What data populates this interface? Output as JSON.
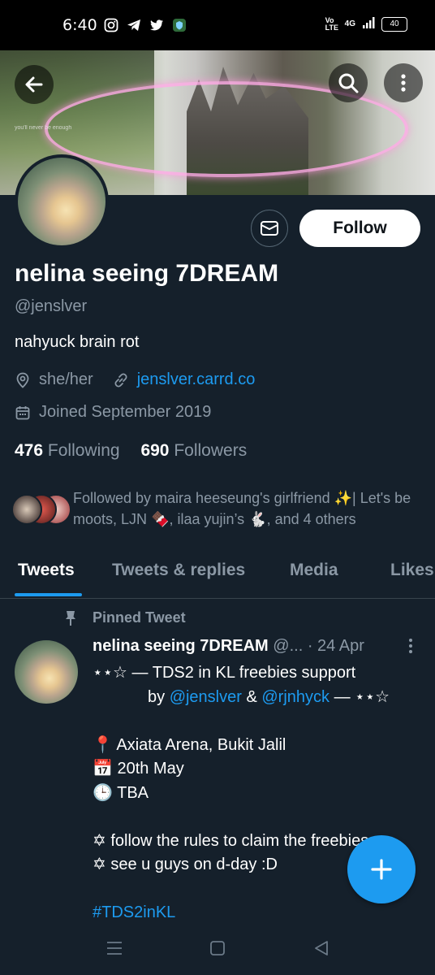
{
  "status_bar": {
    "time": "6:40",
    "signal_label": "4G",
    "volte_label": "Vo LTE",
    "battery": "40"
  },
  "header": {
    "back_icon": "arrow-left-icon",
    "search_icon": "search-icon",
    "more_icon": "more-vertical-icon",
    "banner_caption": "you'll never be enough"
  },
  "profile": {
    "display_name": "nelina seeing 7DREAM",
    "handle": "@jenslver",
    "bio": "nahyuck brain rot",
    "pronouns": "she/her",
    "website": "jenslver.carrd.co",
    "joined": "Joined September 2019",
    "following_count": "476",
    "following_label": "Following",
    "followers_count": "690",
    "followers_label": "Followers",
    "followed_by": "Followed by maira heeseung's girlfriend ✨| Let's be moots, LJN 🍫, ilaa yujin’s 🐇, and 4 others"
  },
  "actions": {
    "follow_label": "Follow"
  },
  "tabs": [
    {
      "label": "Tweets",
      "active": true
    },
    {
      "label": "Tweets & replies",
      "active": false
    },
    {
      "label": "Media",
      "active": false
    },
    {
      "label": "Likes",
      "active": false
    }
  ],
  "pinned_tweet": {
    "pinned_label": "Pinned Tweet",
    "author_name": "nelina seeing 7DREAM",
    "author_handle": "@...",
    "date": "· 24 Apr",
    "line1": "⋆⋆☆ — TDS2 in KL freebies support",
    "line2_prefix": "by ",
    "mention1": "@jenslver",
    "line2_mid": " & ",
    "mention2": "@rjnhyck",
    "line2_suffix": " — ⋆⋆☆",
    "venue": "📍 Axiata Arena, Bukit Jalil",
    "date_line": "📅 20th May",
    "time_line": "🕒 TBA",
    "rule1": "✡ follow the rules to claim the freebies",
    "rule2": "✡ see u guys on d-day :D",
    "hashtag": "#TDS2inKL"
  },
  "colors": {
    "background": "#15202b",
    "accent": "#1d9bf0",
    "muted": "#8b98a5",
    "divider": "#38444d"
  }
}
